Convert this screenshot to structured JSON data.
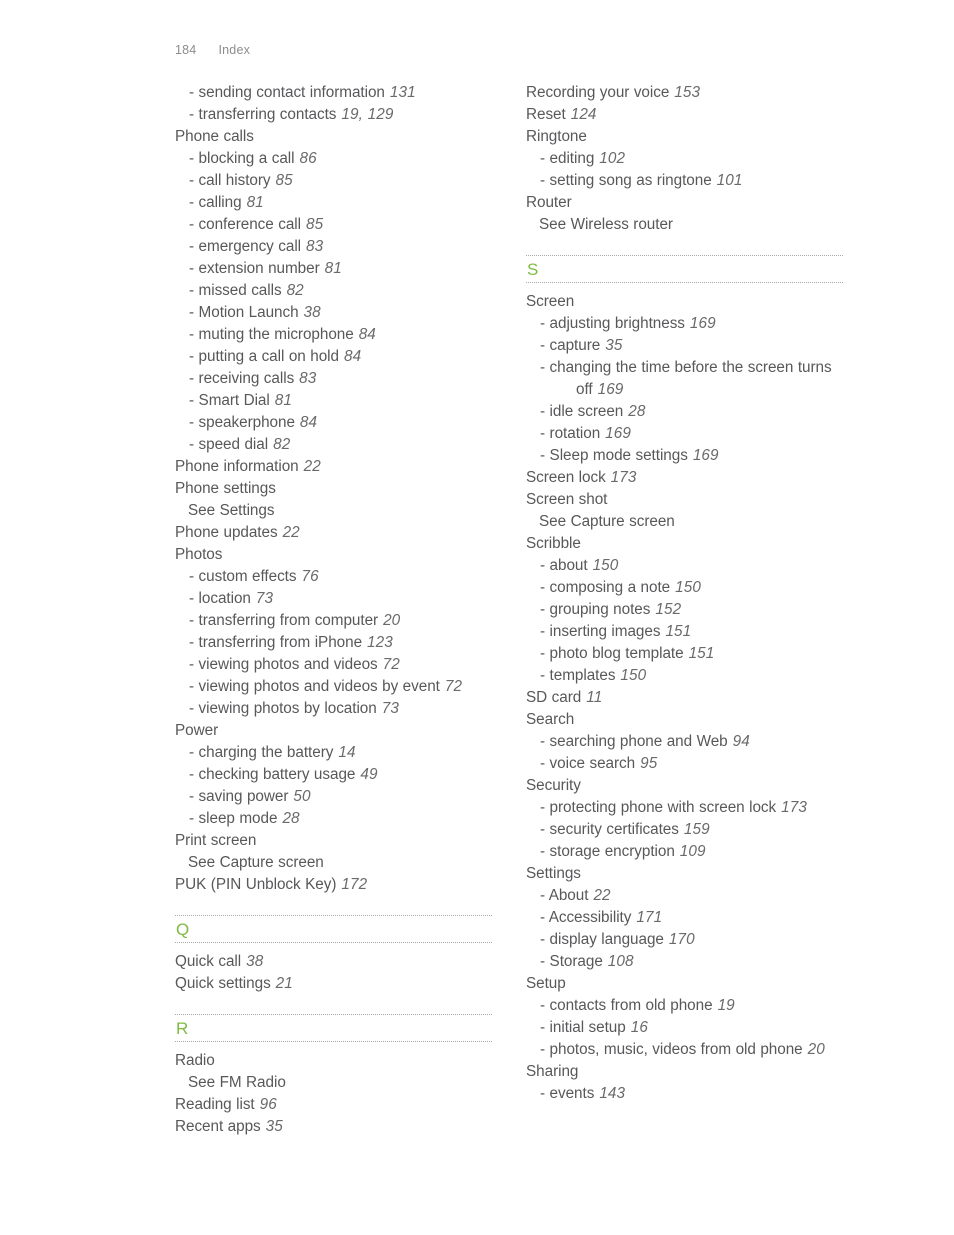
{
  "page": {
    "folio": "184",
    "running_title": "Index",
    "accent_color": "#7fbb42",
    "text_color": "#58585a"
  },
  "columns": [
    {
      "name": "left-column",
      "blocks": [
        {
          "type": "entries",
          "entries": [
            {
              "level": 1,
              "text": "- sending contact information",
              "page": "131"
            },
            {
              "level": 1,
              "text": "- transferring contacts",
              "page": "19, 129"
            },
            {
              "level": 0,
              "text": "Phone calls",
              "page": ""
            },
            {
              "level": 1,
              "text": "- blocking a call",
              "page": "86"
            },
            {
              "level": 1,
              "text": "- call history",
              "page": "85"
            },
            {
              "level": 1,
              "text": "- calling",
              "page": "81"
            },
            {
              "level": 1,
              "text": "- conference call",
              "page": "85"
            },
            {
              "level": 1,
              "text": "- emergency call",
              "page": "83"
            },
            {
              "level": 1,
              "text": "- extension number",
              "page": "81"
            },
            {
              "level": 1,
              "text": "- missed calls",
              "page": "82"
            },
            {
              "level": 1,
              "text": "- Motion Launch",
              "page": "38"
            },
            {
              "level": 1,
              "text": "- muting the microphone",
              "page": "84"
            },
            {
              "level": 1,
              "text": "- putting a call on hold",
              "page": "84"
            },
            {
              "level": 1,
              "text": "- receiving calls",
              "page": "83"
            },
            {
              "level": 1,
              "text": "- Smart Dial",
              "page": "81"
            },
            {
              "level": 1,
              "text": "- speakerphone",
              "page": "84"
            },
            {
              "level": 1,
              "text": "- speed dial",
              "page": "82"
            },
            {
              "level": 0,
              "text": "Phone information",
              "page": "22"
            },
            {
              "level": 0,
              "text": "Phone settings",
              "page": ""
            },
            {
              "level": "see",
              "text": "See Settings",
              "page": ""
            },
            {
              "level": 0,
              "text": "Phone updates",
              "page": "22"
            },
            {
              "level": 0,
              "text": "Photos",
              "page": ""
            },
            {
              "level": 1,
              "text": "- custom effects",
              "page": "76"
            },
            {
              "level": 1,
              "text": "- location",
              "page": "73"
            },
            {
              "level": 1,
              "text": "- transferring from computer",
              "page": "20"
            },
            {
              "level": 1,
              "text": "- transferring from iPhone",
              "page": "123"
            },
            {
              "level": 1,
              "text": "- viewing photos and videos",
              "page": "72"
            },
            {
              "level": 1,
              "text": "- viewing photos and videos by event",
              "page": "72"
            },
            {
              "level": 1,
              "text": "- viewing photos by location",
              "page": "73"
            },
            {
              "level": 0,
              "text": "Power",
              "page": ""
            },
            {
              "level": 1,
              "text": "- charging the battery",
              "page": "14"
            },
            {
              "level": 1,
              "text": "- checking battery usage",
              "page": "49"
            },
            {
              "level": 1,
              "text": "- saving power",
              "page": "50"
            },
            {
              "level": 1,
              "text": "- sleep mode",
              "page": "28"
            },
            {
              "level": 0,
              "text": "Print screen",
              "page": ""
            },
            {
              "level": "see",
              "text": "See Capture screen",
              "page": ""
            },
            {
              "level": 0,
              "text": "PUK (PIN Unblock Key)",
              "page": "172"
            }
          ]
        },
        {
          "type": "letter",
          "letter": "Q"
        },
        {
          "type": "entries",
          "entries": [
            {
              "level": 0,
              "text": "Quick call",
              "page": "38"
            },
            {
              "level": 0,
              "text": "Quick settings",
              "page": "21"
            }
          ]
        },
        {
          "type": "letter",
          "letter": "R"
        },
        {
          "type": "entries",
          "entries": [
            {
              "level": 0,
              "text": "Radio",
              "page": ""
            },
            {
              "level": "see",
              "text": "See FM Radio",
              "page": ""
            },
            {
              "level": 0,
              "text": "Reading list",
              "page": "96"
            },
            {
              "level": 0,
              "text": "Recent apps",
              "page": "35"
            }
          ]
        }
      ]
    },
    {
      "name": "right-column",
      "blocks": [
        {
          "type": "entries",
          "entries": [
            {
              "level": 0,
              "text": "Recording your voice",
              "page": "153"
            },
            {
              "level": 0,
              "text": "Reset",
              "page": "124"
            },
            {
              "level": 0,
              "text": "Ringtone",
              "page": ""
            },
            {
              "level": 1,
              "text": "- editing",
              "page": "102"
            },
            {
              "level": 1,
              "text": "- setting song as ringtone",
              "page": "101"
            },
            {
              "level": 0,
              "text": "Router",
              "page": ""
            },
            {
              "level": "see",
              "text": "See Wireless router",
              "page": ""
            }
          ]
        },
        {
          "type": "letter",
          "letter": "S"
        },
        {
          "type": "entries",
          "entries": [
            {
              "level": 0,
              "text": "Screen",
              "page": ""
            },
            {
              "level": 1,
              "text": "- adjusting brightness",
              "page": "169"
            },
            {
              "level": 1,
              "text": "- capture",
              "page": "35"
            },
            {
              "level": 1,
              "text": "- changing the time before the screen turns off",
              "page": "169"
            },
            {
              "level": 1,
              "text": "- idle screen",
              "page": "28"
            },
            {
              "level": 1,
              "text": "- rotation",
              "page": "169"
            },
            {
              "level": 1,
              "text": "- Sleep mode settings",
              "page": "169"
            },
            {
              "level": 0,
              "text": "Screen lock",
              "page": "173"
            },
            {
              "level": 0,
              "text": "Screen shot",
              "page": ""
            },
            {
              "level": "see",
              "text": "See Capture screen",
              "page": ""
            },
            {
              "level": 0,
              "text": "Scribble",
              "page": ""
            },
            {
              "level": 1,
              "text": "- about",
              "page": "150"
            },
            {
              "level": 1,
              "text": "- composing a note",
              "page": "150"
            },
            {
              "level": 1,
              "text": "- grouping notes",
              "page": "152"
            },
            {
              "level": 1,
              "text": "- inserting images",
              "page": "151"
            },
            {
              "level": 1,
              "text": "- photo blog template",
              "page": "151"
            },
            {
              "level": 1,
              "text": "- templates",
              "page": "150"
            },
            {
              "level": 0,
              "text": "SD card",
              "page": "11"
            },
            {
              "level": 0,
              "text": "Search",
              "page": ""
            },
            {
              "level": 1,
              "text": "- searching phone and Web",
              "page": "94"
            },
            {
              "level": 1,
              "text": "- voice search",
              "page": "95"
            },
            {
              "level": 0,
              "text": "Security",
              "page": ""
            },
            {
              "level": 1,
              "text": "- protecting phone with screen lock",
              "page": "173"
            },
            {
              "level": 1,
              "text": "- security certificates",
              "page": "159"
            },
            {
              "level": 1,
              "text": "- storage encryption",
              "page": "109"
            },
            {
              "level": 0,
              "text": "Settings",
              "page": ""
            },
            {
              "level": 1,
              "text": "- About",
              "page": "22"
            },
            {
              "level": 1,
              "text": "- Accessibility",
              "page": "171"
            },
            {
              "level": 1,
              "text": "- display language",
              "page": "170"
            },
            {
              "level": 1,
              "text": "- Storage",
              "page": "108"
            },
            {
              "level": 0,
              "text": "Setup",
              "page": ""
            },
            {
              "level": 1,
              "text": "- contacts from old phone",
              "page": "19"
            },
            {
              "level": 1,
              "text": "- initial setup",
              "page": "16"
            },
            {
              "level": 1,
              "text": "- photos, music, videos from old phone",
              "page": "20"
            },
            {
              "level": 0,
              "text": "Sharing",
              "page": ""
            },
            {
              "level": 1,
              "text": "- events",
              "page": "143"
            }
          ]
        }
      ]
    }
  ]
}
